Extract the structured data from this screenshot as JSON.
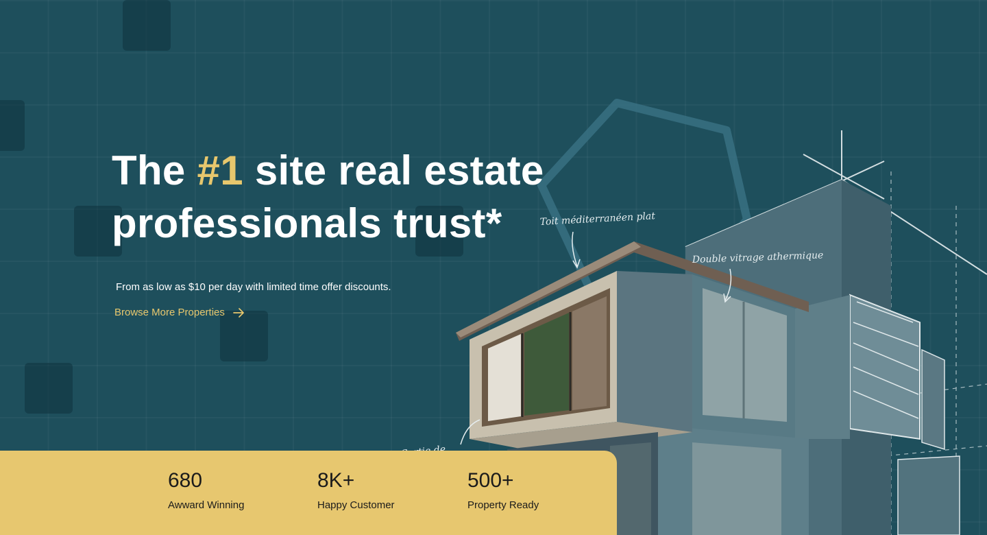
{
  "hero": {
    "headline_pre": "The ",
    "headline_accent": "#1",
    "headline_post": " site real estate",
    "headline_line2": "professionals trust*",
    "subline": "From as low as $10 per day with limited time offer discounts.",
    "cta_label": "Browse More Properties",
    "accent_color": "#e7c76d",
    "background_color": "#1e4f5c"
  },
  "illustration": {
    "annotation_roof": "Toit méditerranéen plat",
    "annotation_glazing": "Double vitrage athermique",
    "annotation_partial": "Sortie de"
  },
  "stats": [
    {
      "value": "680",
      "label": "Awward Winning"
    },
    {
      "value": "8K+",
      "label": "Happy Customer"
    },
    {
      "value": "500+",
      "label": "Property Ready"
    }
  ],
  "stats_bar_color": "#e7c76f"
}
